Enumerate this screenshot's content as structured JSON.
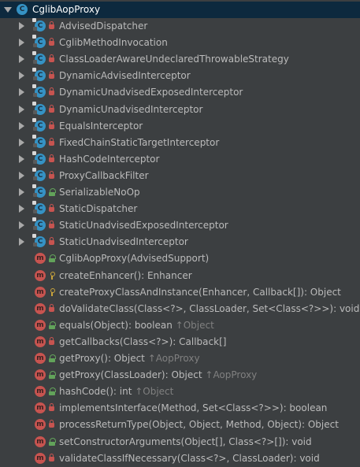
{
  "root": {
    "label": "CglibAopProxy",
    "icon": "class-icon"
  },
  "inherited_mark": "↑",
  "inner_classes": [
    {
      "label": "AdvisedDispatcher",
      "visibility": "private",
      "static": true
    },
    {
      "label": "CglibMethodInvocation",
      "visibility": "private",
      "static": true
    },
    {
      "label": "ClassLoaderAwareUndeclaredThrowableStrategy",
      "visibility": "private",
      "static": true
    },
    {
      "label": "DynamicAdvisedInterceptor",
      "visibility": "private",
      "static": true
    },
    {
      "label": "DynamicUnadvisedExposedInterceptor",
      "visibility": "private",
      "static": true
    },
    {
      "label": "DynamicUnadvisedInterceptor",
      "visibility": "private",
      "static": true
    },
    {
      "label": "EqualsInterceptor",
      "visibility": "private",
      "static": true
    },
    {
      "label": "FixedChainStaticTargetInterceptor",
      "visibility": "private",
      "static": true
    },
    {
      "label": "HashCodeInterceptor",
      "visibility": "private",
      "static": true
    },
    {
      "label": "ProxyCallbackFilter",
      "visibility": "private",
      "static": true
    },
    {
      "label": "SerializableNoOp",
      "visibility": "public",
      "static": true
    },
    {
      "label": "StaticDispatcher",
      "visibility": "private",
      "static": true
    },
    {
      "label": "StaticUnadvisedExposedInterceptor",
      "visibility": "private",
      "static": true
    },
    {
      "label": "StaticUnadvisedInterceptor",
      "visibility": "private",
      "static": true
    }
  ],
  "methods": [
    {
      "label": "CglibAopProxy(AdvisedSupport)",
      "visibility": "public",
      "inherited": ""
    },
    {
      "label": "createEnhancer(): Enhancer",
      "visibility": "protected",
      "inherited": ""
    },
    {
      "label": "createProxyClassAndInstance(Enhancer, Callback[]): Object",
      "visibility": "protected",
      "inherited": ""
    },
    {
      "label": "doValidateClass(Class<?>, ClassLoader, Set<Class<?>>): void",
      "visibility": "private",
      "inherited": ""
    },
    {
      "label": "equals(Object): boolean ",
      "visibility": "public",
      "inherited": "Object"
    },
    {
      "label": "getCallbacks(Class<?>): Callback[]",
      "visibility": "private",
      "inherited": ""
    },
    {
      "label": "getProxy(): Object ",
      "visibility": "public",
      "inherited": "AopProxy"
    },
    {
      "label": "getProxy(ClassLoader): Object ",
      "visibility": "public",
      "inherited": "AopProxy"
    },
    {
      "label": "hashCode(): int ",
      "visibility": "public",
      "inherited": "Object"
    },
    {
      "label": "implementsInterface(Method, Set<Class<?>>): boolean",
      "visibility": "private",
      "inherited": ""
    },
    {
      "label": "processReturnType(Object, Object, Method, Object): Object",
      "visibility": "private",
      "inherited": ""
    },
    {
      "label": "setConstructorArguments(Object[], Class<?>[]): void",
      "visibility": "public",
      "inherited": ""
    },
    {
      "label": "validateClassIfNecessary(Class<?>, ClassLoader): void",
      "visibility": "private",
      "inherited": ""
    }
  ]
}
